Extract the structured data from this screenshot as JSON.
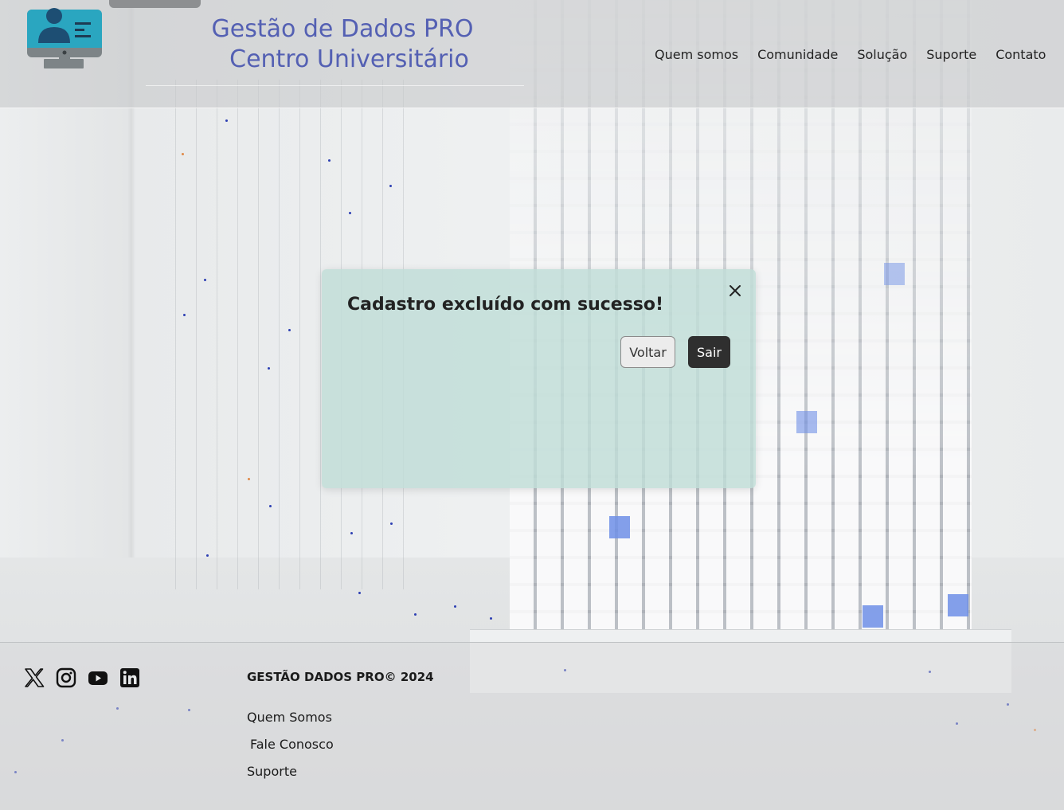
{
  "header": {
    "brand_line1": "Gestão de Dados PRO",
    "brand_line2": "Centro Universitário",
    "nav": [
      {
        "label": "Quem somos"
      },
      {
        "label": "Comunidade"
      },
      {
        "label": "Solução"
      },
      {
        "label": "Suporte"
      },
      {
        "label": "Contato"
      }
    ]
  },
  "modal": {
    "message": "Cadastro excluído com sucesso!",
    "back_label": "Voltar",
    "exit_label": "Sair",
    "close_icon": "close-icon"
  },
  "footer": {
    "social_icons": [
      "x-twitter-icon",
      "instagram-icon",
      "youtube-icon",
      "linkedin-icon"
    ],
    "copyright": "GESTÃO DADOS PRO© 2024",
    "links": [
      {
        "label": "Quem Somos"
      },
      {
        "label": "Fale Conosco"
      },
      {
        "label": "Suporte"
      }
    ]
  },
  "colors": {
    "brand_text": "#5460b3",
    "modal_bg": "#bfddd7",
    "primary_button": "#2f2f2f",
    "secondary_button": "#ececec"
  }
}
